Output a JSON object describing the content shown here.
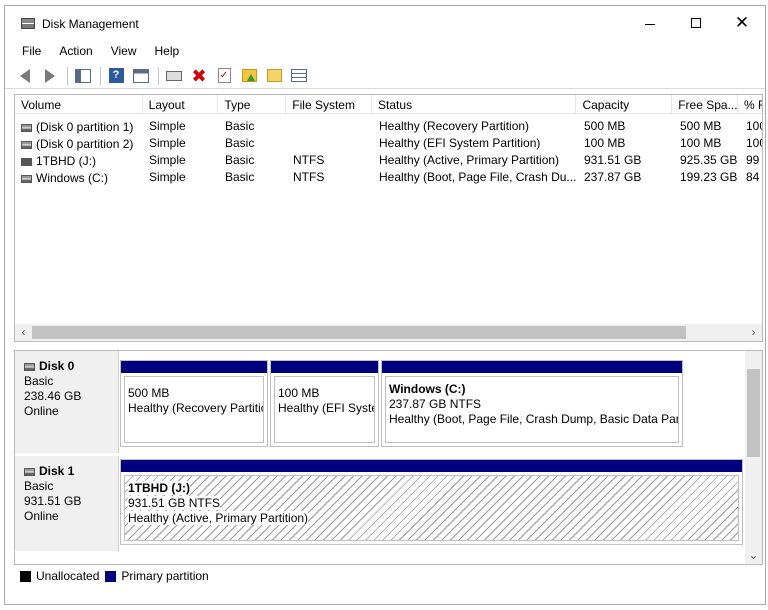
{
  "window": {
    "title": "Disk Management",
    "minimize_icon": "minimize-icon",
    "maximize_icon": "maximize-icon",
    "close_icon": "close-icon",
    "close_glyph": "✕"
  },
  "menu": [
    "File",
    "Action",
    "View",
    "Help"
  ],
  "toolbar": {
    "help_glyph": "?",
    "delete_glyph": "✖",
    "check_glyph": "✓",
    "icons": [
      "back-arrow-icon",
      "forward-arrow-icon",
      "show-hide-console-tree-icon",
      "help-icon",
      "console-icon",
      "connect-drive-icon",
      "delete-icon",
      "check-icon",
      "new-folder-icon",
      "find-icon",
      "properties-icon"
    ]
  },
  "volume_list": {
    "columns": [
      "Volume",
      "Layout",
      "Type",
      "File System",
      "Status",
      "Capacity",
      "Free Spa...",
      "% F"
    ],
    "rows": [
      {
        "volume": "(Disk 0 partition 1)",
        "layout": "Simple",
        "type": "Basic",
        "fs": "",
        "status": "Healthy (Recovery Partition)",
        "capacity": "500 MB",
        "free": "500 MB",
        "pct": "100"
      },
      {
        "volume": "(Disk 0 partition 2)",
        "layout": "Simple",
        "type": "Basic",
        "fs": "",
        "status": "Healthy (EFI System Partition)",
        "capacity": "100 MB",
        "free": "100 MB",
        "pct": "100"
      },
      {
        "volume": "1TBHD (J:)",
        "layout": "Simple",
        "type": "Basic",
        "fs": "NTFS",
        "status": "Healthy (Active, Primary Partition)",
        "capacity": "931.51 GB",
        "free": "925.35 GB",
        "pct": "99"
      },
      {
        "volume": "Windows (C:)",
        "layout": "Simple",
        "type": "Basic",
        "fs": "NTFS",
        "status": "Healthy (Boot, Page File, Crash Du...",
        "capacity": "237.87 GB",
        "free": "199.23 GB",
        "pct": "84"
      }
    ],
    "scroll_left": "‹",
    "scroll_right": "›"
  },
  "disks": [
    {
      "name": "Disk 0",
      "type": "Basic",
      "size": "238.46 GB",
      "status": "Online",
      "partitions": [
        {
          "title": "",
          "size": "500 MB",
          "status": "Healthy (Recovery Partition)"
        },
        {
          "title": "",
          "size": "100 MB",
          "status": "Healthy (EFI System Partition)"
        },
        {
          "title": "Windows  (C:)",
          "size": "237.87 GB NTFS",
          "status": "Healthy (Boot, Page File, Crash Dump, Basic Data Partition)"
        }
      ]
    },
    {
      "name": "Disk 1",
      "type": "Basic",
      "size": "931.51 GB",
      "status": "Online",
      "partitions": [
        {
          "title": "1TBHD  (J:)",
          "size": "931.51 GB NTFS",
          "status": "Healthy (Active, Primary Partition)"
        }
      ]
    }
  ],
  "disk_pane": {
    "scroll_down": "⌄"
  },
  "legend": [
    {
      "label": "Unallocated",
      "color": "#000000"
    },
    {
      "label": "Primary partition",
      "color": "#00007f"
    }
  ],
  "colors": {
    "primary_partition": "#00007f",
    "unallocated": "#000000"
  }
}
